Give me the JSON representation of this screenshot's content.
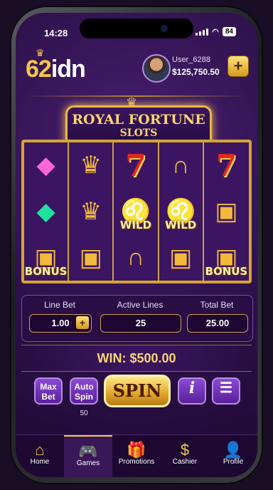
{
  "status": {
    "time": "14:28",
    "battery": "84"
  },
  "brand": {
    "logo_num": "62",
    "logo_text": "idn"
  },
  "user": {
    "name": "User_6288",
    "balance": "$125,750.50",
    "add_label": "+"
  },
  "game": {
    "title_line1": "ROYAL FORTUNE",
    "title_line2": "SLOTS"
  },
  "reels": [
    [
      {
        "icon": "diamond-pink-icon",
        "glyph": "◆"
      },
      {
        "icon": "diamond-green-icon",
        "glyph": "◆"
      },
      {
        "icon": "treasure-chest-icon",
        "glyph": "▣",
        "label": "BONUS"
      }
    ],
    [
      {
        "icon": "crown-icon",
        "glyph": "♛"
      },
      {
        "icon": "crown-icon",
        "glyph": "♛"
      },
      {
        "icon": "treasure-chest-icon",
        "glyph": "▣"
      }
    ],
    [
      {
        "icon": "seven-icon",
        "glyph": "7"
      },
      {
        "icon": "lion-icon",
        "glyph": "♌",
        "label": "WILD"
      },
      {
        "icon": "horseshoe-icon",
        "glyph": "∩"
      }
    ],
    [
      {
        "icon": "horseshoe-icon",
        "glyph": "∩"
      },
      {
        "icon": "lion-icon",
        "glyph": "♌",
        "label": "WILD"
      },
      {
        "icon": "treasure-chest-icon",
        "glyph": "▣"
      }
    ],
    [
      {
        "icon": "seven-icon",
        "glyph": "7"
      },
      {
        "icon": "treasure-chest-icon",
        "glyph": "▣"
      },
      {
        "icon": "treasure-chest-icon",
        "glyph": "▣",
        "label": "BONUS"
      }
    ]
  ],
  "bets": {
    "line_bet_label": "Line Bet",
    "line_bet_value": "1.00",
    "active_lines_label": "Active Lines",
    "active_lines_value": "25",
    "total_bet_label": "Total Bet",
    "total_bet_value": "25.00"
  },
  "win_text": "WIN: $500.00",
  "controls": {
    "max_bet": "Max Bet",
    "auto_spin": "Auto Spin",
    "auto_spin_count": "50",
    "spin": "SPIN",
    "info": "i",
    "menu": "☰"
  },
  "nav": [
    {
      "label": "Home",
      "icon": "home-icon",
      "glyph": "⌂"
    },
    {
      "label": "Games",
      "icon": "gamepad-icon",
      "glyph": "🎮"
    },
    {
      "label": "Promotions",
      "icon": "gift-icon",
      "glyph": "🎁"
    },
    {
      "label": "Cashier",
      "icon": "cashier-icon",
      "glyph": "$"
    },
    {
      "label": "Profile",
      "icon": "profile-icon",
      "glyph": "👤"
    }
  ]
}
